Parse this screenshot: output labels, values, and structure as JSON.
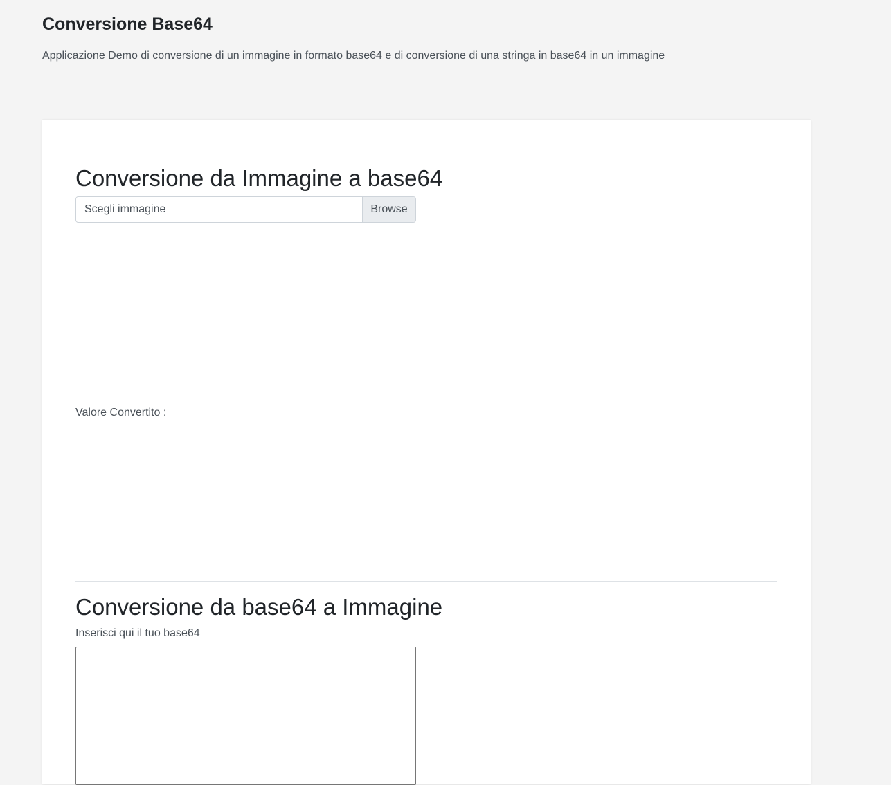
{
  "header": {
    "title": "Conversione Base64",
    "subtitle": "Applicazione Demo di conversione di un immagine in formato base64 e di conversione di una stringa in base64 in un immagine"
  },
  "image_to_base64": {
    "title": "Conversione da Immagine a base64",
    "file_input": {
      "placeholder": "Scegli immagine",
      "browse_label": "Browse"
    },
    "converted_label": "Valore Convertito :"
  },
  "base64_to_image": {
    "title": "Conversione da base64 a Immagine",
    "textarea_label": "Inserisci qui il tuo base64",
    "textarea_value": ""
  }
}
